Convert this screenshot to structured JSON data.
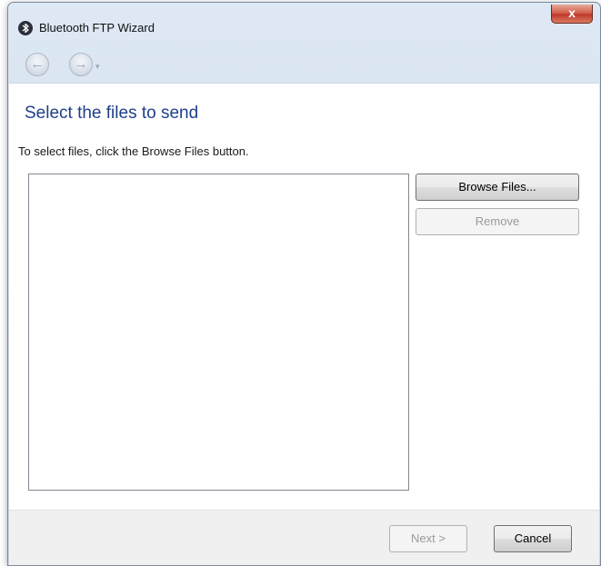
{
  "window": {
    "title": "Bluetooth FTP Wizard",
    "close_label": "x"
  },
  "nav": {
    "back_icon": "back-arrow-icon",
    "forward_icon": "forward-arrow-icon",
    "back_glyph": "←",
    "forward_glyph": "→",
    "dropdown_glyph": "▾"
  },
  "page": {
    "heading": "Select the files to send",
    "instruction": "To select files, click the Browse Files button."
  },
  "file_list": {
    "items": []
  },
  "buttons": {
    "browse": "Browse Files...",
    "remove": "Remove",
    "next": "Next >",
    "cancel": "Cancel"
  },
  "colors": {
    "heading": "#1e3f8a",
    "title_bar": "#d3dfee",
    "close_button": "#c0392b"
  }
}
